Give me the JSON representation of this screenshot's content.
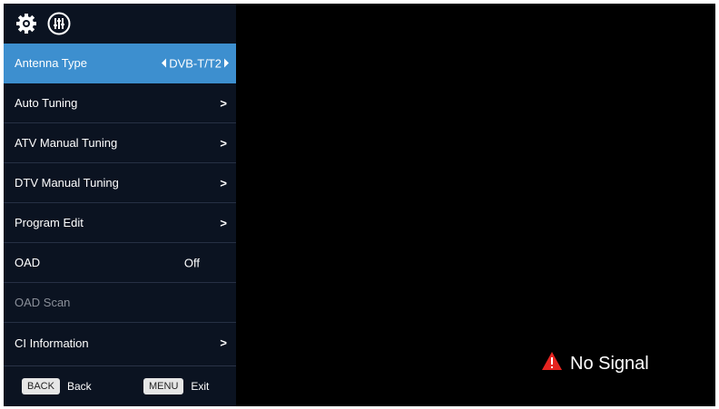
{
  "header": {
    "icons": [
      "gear-icon",
      "equalizer-icon"
    ]
  },
  "menu": {
    "items": [
      {
        "label": "Antenna Type",
        "value": "DVB-T/T2",
        "selected": true
      },
      {
        "label": "Auto Tuning"
      },
      {
        "label": "ATV Manual Tuning"
      },
      {
        "label": "DTV Manual Tuning"
      },
      {
        "label": "Program Edit"
      },
      {
        "label": "OAD",
        "value": "Off"
      },
      {
        "label": "OAD Scan",
        "disabled": true
      },
      {
        "label": "CI Information"
      }
    ]
  },
  "footer": {
    "back_key": "BACK",
    "back_label": "Back",
    "menu_key": "MENU",
    "menu_label": "Exit"
  },
  "status": {
    "no_signal": "No Signal",
    "icon": "warning-icon"
  },
  "colors": {
    "selected_bg": "#3d8fcf",
    "menu_bg": "#0b1321",
    "warning": "#e52420"
  }
}
